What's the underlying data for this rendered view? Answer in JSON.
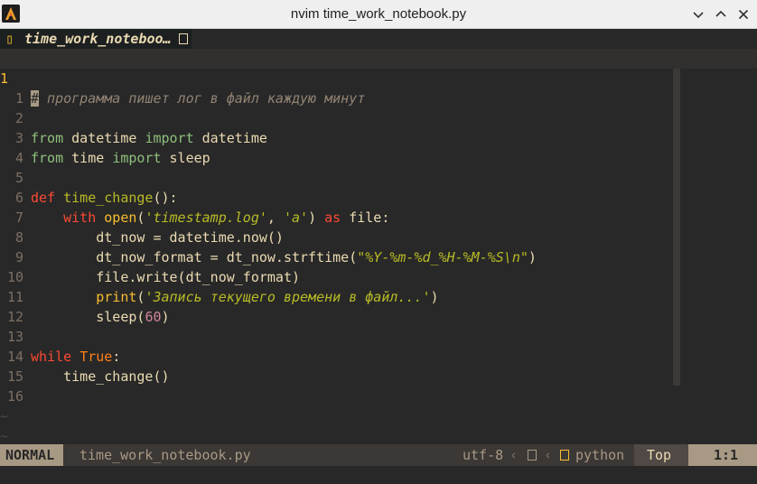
{
  "window": {
    "title": "nvim time_work_notebook.py",
    "controls": [
      "minimize",
      "maximize",
      "close"
    ]
  },
  "tabline": {
    "active_tab": "time_work_noteboo…"
  },
  "editor": {
    "line1_comment": "# программа пишет лог в файл каждую минут",
    "line1_number": "1",
    "line_numbers": [
      "1",
      "2",
      "3",
      "4",
      "5",
      "6",
      "7",
      "8",
      "9",
      "10",
      "11",
      "12",
      "13",
      "14",
      "15",
      "16"
    ],
    "code": {
      "l2": [
        "from",
        " datetime ",
        "import",
        " datetime"
      ],
      "l3": [
        "from",
        " time ",
        "import",
        " sleep"
      ],
      "l5": [
        "def",
        " ",
        "time_change",
        "():"
      ],
      "l6": [
        "    ",
        "with",
        " ",
        "open",
        "(",
        "'timestamp.log'",
        ", ",
        "'a'",
        ") ",
        "as",
        " file:"
      ],
      "l7": "        dt_now = datetime.now()",
      "l8": [
        "        dt_now_format = dt_now.strftime(",
        "\"%Y-%m-%d_%H-%M-%S\\n\"",
        ")"
      ],
      "l9": "        file.write(dt_now_format)",
      "l10": [
        "        ",
        "print",
        "(",
        "'Запись текущего времени в файл...'",
        ")"
      ],
      "l11": [
        "        sleep(",
        "60",
        ")"
      ],
      "l13": [
        "while",
        " ",
        "True",
        ":"
      ],
      "l14": "    time_change()"
    },
    "tilde": "~"
  },
  "statusline": {
    "mode": "NORMAL",
    "file": "time_work_notebook.py",
    "encoding": "utf-8",
    "filetype": "python",
    "position_label": "Top",
    "cursor_pos": "1:1"
  },
  "colors": {
    "bg": "#282828",
    "keyword": "#fb4934",
    "string": "#b8bb26",
    "comment": "#928374",
    "import": "#8ec07c",
    "number": "#d3869b",
    "cursor_line_number": "#fabd2f"
  }
}
